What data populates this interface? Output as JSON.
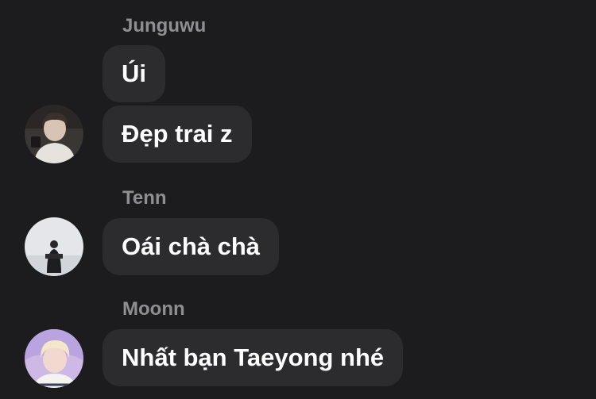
{
  "colors": {
    "background": "#1c1c1e",
    "bubble": "#2c2c2e",
    "sender_name": "#8e8e93",
    "message_text": "#ffffff"
  },
  "groups": [
    {
      "sender": "Junguwu",
      "avatar": "avatar-junguwu",
      "messages": [
        "Úi",
        "Đẹp trai z"
      ]
    },
    {
      "sender": "Tenn",
      "avatar": "avatar-tenn",
      "messages": [
        "Oái chà chà"
      ]
    },
    {
      "sender": "Moonn",
      "avatar": "avatar-moonn",
      "messages": [
        "Nhất bạn Taeyong nhé"
      ]
    }
  ]
}
